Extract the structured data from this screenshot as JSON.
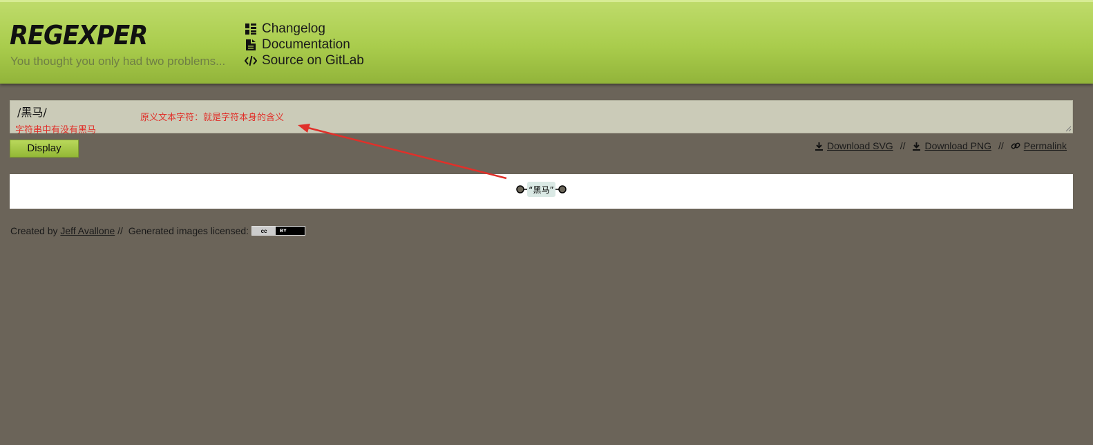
{
  "header": {
    "logo": "REGEXPER",
    "tagline": "You thought you only had two problems...",
    "nav": [
      {
        "label": "Changelog",
        "icon": "list-icon"
      },
      {
        "label": "Documentation",
        "icon": "document-icon"
      },
      {
        "label": "Source on GitLab",
        "icon": "code-icon"
      }
    ]
  },
  "regex": {
    "value": "/黑马/",
    "annotation_left": "字符串中有没有黑马",
    "annotation_right": "原义文本字符：就是字符本身的含义"
  },
  "actions": {
    "display_label": "Display",
    "download_svg": "Download SVG",
    "download_png": "Download PNG",
    "permalink": "Permalink",
    "separator": "//"
  },
  "diagram": {
    "literal": "“黑马”"
  },
  "footer": {
    "created_by": "Created by",
    "author": "Jeff Avallone",
    "separator": "//",
    "license_text": "Generated images licensed:",
    "license_badge_left": "cc",
    "license_badge_right": "BY"
  },
  "colors": {
    "background": "#6b6459",
    "header_green": "#a9cc4c",
    "annotation_red": "#e0302a",
    "input_bg": "#cbcbb8"
  }
}
